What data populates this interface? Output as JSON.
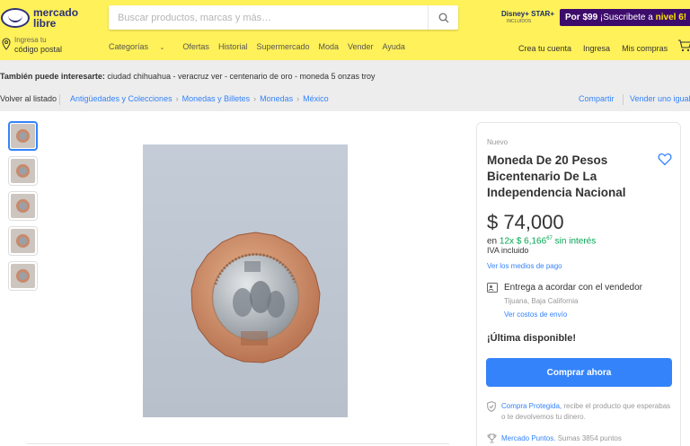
{
  "header": {
    "logo_line1": "mercado",
    "logo_line2": "libre",
    "search_placeholder": "Buscar productos, marcas y más…",
    "promo_disney": "Disney+ STAR+",
    "promo_incluidos": "INCLUIDOS",
    "promo_price": "Por $99",
    "promo_text": "¡Suscribete a",
    "promo_level": "nivel 6!",
    "location_line1": "Ingresa tu",
    "location_line2": "código postal",
    "nav": [
      "Categorías",
      "Ofertas",
      "Historial",
      "Supermercado",
      "Moda",
      "Vender",
      "Ayuda"
    ],
    "user_nav": [
      "Crea tu cuenta",
      "Ingresa",
      "Mis compras"
    ]
  },
  "interest": {
    "label": "También puede interesarte:",
    "items": "ciudad chihuahua - veracruz ver - centenario de oro - moneda 5 onzas troy"
  },
  "breadcrumb": {
    "back": "Volver al listado",
    "items": [
      "Antigüedades y Colecciones",
      "Monedas y Billetes",
      "Monedas",
      "México"
    ],
    "share": "Compartir",
    "sell": "Vender uno igual"
  },
  "product": {
    "condition": "Nuevo",
    "title": "Moneda De 20 Pesos Bicentenario De La Independencia Nacional",
    "price": "$ 74,000",
    "installments_prefix": "en",
    "installments_count": "12x",
    "installments_amount": "$ 6,166",
    "installments_cents": "67",
    "installments_suffix": "sin interés",
    "iva": "IVA incluido",
    "payment_link": "Ver los medios de pago",
    "shipping": "Entrega a acordar con el vendedor",
    "shipping_location": "Tijuana, Baja California",
    "shipping_link": "Ver costos de envío",
    "stock": "¡Última disponible!",
    "buy_button": "Comprar ahora",
    "protection_link": "Compra Protegida,",
    "protection_text": "recibe el producto que esperabas o te devolvemos tu dinero.",
    "points_link": "Mercado Puntos.",
    "points_text": "Sumas 3854 puntos"
  },
  "colors": {
    "header_bg": "#fff159",
    "accent_blue": "#3483fa",
    "green": "#00a650",
    "promo_bg": "#3d0b6b"
  }
}
